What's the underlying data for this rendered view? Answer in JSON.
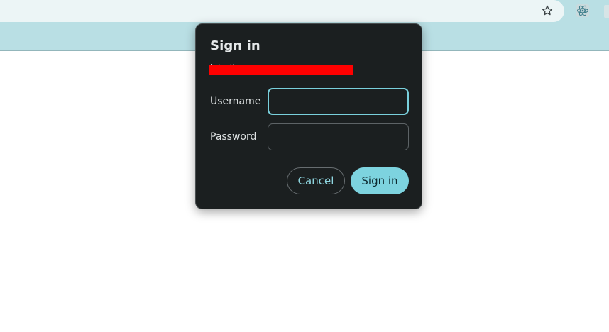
{
  "browser": {
    "icons": {
      "bookmark": "star-icon",
      "extension": "react-extension-icon"
    }
  },
  "dialog": {
    "title": "Sign in",
    "url": "http://",
    "fields": [
      {
        "label": "Username",
        "value": "",
        "type": "text"
      },
      {
        "label": "Password",
        "value": "",
        "type": "password"
      }
    ],
    "buttons": {
      "cancel": "Cancel",
      "submit": "Sign in"
    }
  },
  "colors": {
    "dialog_bg": "#1b1f20",
    "accent": "#7dd3df",
    "toolbar": "#b9dfe4",
    "redaction": "#ff0000"
  }
}
